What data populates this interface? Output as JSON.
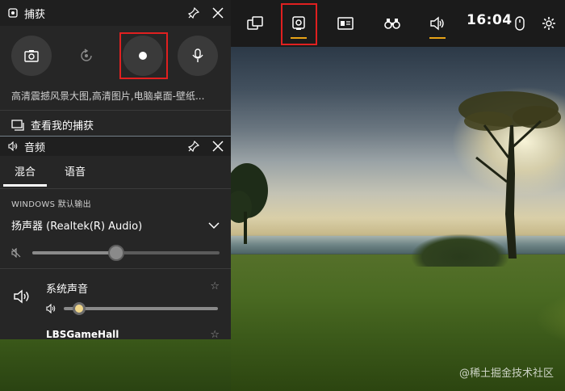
{
  "capture": {
    "title": "捕获",
    "description": "高清震撼风景大图,高清图片,电脑桌面-壁纸...",
    "see_captures": "查看我的捕获"
  },
  "audio": {
    "title": "音频",
    "tabs": [
      "混合",
      "语音"
    ],
    "output_label": "WINDOWS 默认输出",
    "device": "扬声器 (Realtek(R) Audio)",
    "master_volume": 0.45,
    "apps": [
      {
        "name": "系统声音",
        "volume": 0.1
      },
      {
        "name": "LBSGameHall"
      }
    ]
  },
  "topbar": {
    "clock": "16:04"
  },
  "watermark": "@稀土掘金技术社区",
  "colors": {
    "accent": "#e8a317",
    "highlight_box": "#e02020"
  }
}
